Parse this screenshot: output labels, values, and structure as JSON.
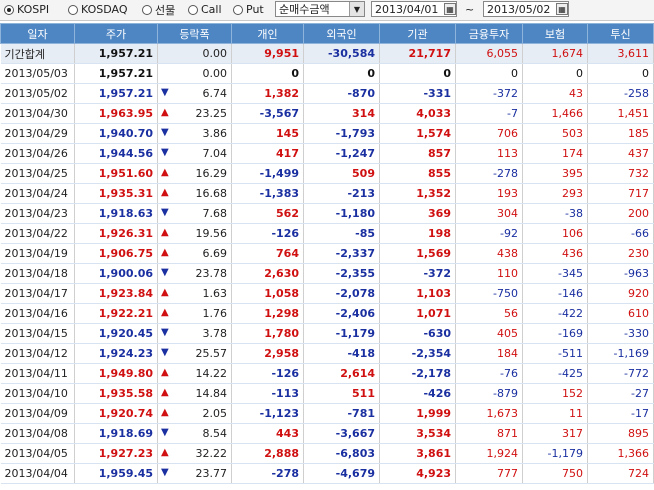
{
  "toolbar": {
    "radios": [
      {
        "label": "KOSPI",
        "selected": true
      },
      {
        "label": "KOSDAQ",
        "selected": false
      },
      {
        "label": "선물",
        "selected": false
      },
      {
        "label": "Call",
        "selected": false
      },
      {
        "label": "Put",
        "selected": false
      }
    ],
    "select_value": "순매수금액",
    "date_from": "2013/04/01",
    "date_to": "2013/05/02",
    "tilde": "~"
  },
  "colors": {
    "header": "#4e86c4",
    "up": "#d01010",
    "down": "#1a2fa0"
  },
  "columns": [
    "일자",
    "주가",
    "등락폭",
    "개인",
    "외국인",
    "기관",
    "금융투자",
    "보험",
    "투신"
  ],
  "rows": [
    {
      "date": "기간합계",
      "price": "1,957.21",
      "dir": "none",
      "change": "0.00",
      "retail": "9,951",
      "foreign": "-30,584",
      "inst": "21,717",
      "fin": "6,055",
      "ins": "1,674",
      "trust": "3,611"
    },
    {
      "date": "2013/05/03",
      "price": "1,957.21",
      "dir": "none",
      "change": "0.00",
      "retail": "0",
      "foreign": "0",
      "inst": "0",
      "fin": "0",
      "ins": "0",
      "trust": "0"
    },
    {
      "date": "2013/05/02",
      "price": "1,957.21",
      "dir": "down",
      "change": "6.74",
      "retail": "1,382",
      "foreign": "-870",
      "inst": "-331",
      "fin": "-372",
      "ins": "43",
      "trust": "-258"
    },
    {
      "date": "2013/04/30",
      "price": "1,963.95",
      "dir": "up",
      "change": "23.25",
      "retail": "-3,567",
      "foreign": "314",
      "inst": "4,033",
      "fin": "-7",
      "ins": "1,466",
      "trust": "1,451"
    },
    {
      "date": "2013/04/29",
      "price": "1,940.70",
      "dir": "down",
      "change": "3.86",
      "retail": "145",
      "foreign": "-1,793",
      "inst": "1,574",
      "fin": "706",
      "ins": "503",
      "trust": "185"
    },
    {
      "date": "2013/04/26",
      "price": "1,944.56",
      "dir": "down",
      "change": "7.04",
      "retail": "417",
      "foreign": "-1,247",
      "inst": "857",
      "fin": "113",
      "ins": "174",
      "trust": "437"
    },
    {
      "date": "2013/04/25",
      "price": "1,951.60",
      "dir": "up",
      "change": "16.29",
      "retail": "-1,499",
      "foreign": "509",
      "inst": "855",
      "fin": "-278",
      "ins": "395",
      "trust": "732"
    },
    {
      "date": "2013/04/24",
      "price": "1,935.31",
      "dir": "up",
      "change": "16.68",
      "retail": "-1,383",
      "foreign": "-213",
      "inst": "1,352",
      "fin": "193",
      "ins": "293",
      "trust": "717"
    },
    {
      "date": "2013/04/23",
      "price": "1,918.63",
      "dir": "down",
      "change": "7.68",
      "retail": "562",
      "foreign": "-1,180",
      "inst": "369",
      "fin": "304",
      "ins": "-38",
      "trust": "200"
    },
    {
      "date": "2013/04/22",
      "price": "1,926.31",
      "dir": "up",
      "change": "19.56",
      "retail": "-126",
      "foreign": "-85",
      "inst": "198",
      "fin": "-92",
      "ins": "106",
      "trust": "-66"
    },
    {
      "date": "2013/04/19",
      "price": "1,906.75",
      "dir": "up",
      "change": "6.69",
      "retail": "764",
      "foreign": "-2,337",
      "inst": "1,569",
      "fin": "438",
      "ins": "436",
      "trust": "230"
    },
    {
      "date": "2013/04/18",
      "price": "1,900.06",
      "dir": "down",
      "change": "23.78",
      "retail": "2,630",
      "foreign": "-2,355",
      "inst": "-372",
      "fin": "110",
      "ins": "-345",
      "trust": "-963"
    },
    {
      "date": "2013/04/17",
      "price": "1,923.84",
      "dir": "up",
      "change": "1.63",
      "retail": "1,058",
      "foreign": "-2,078",
      "inst": "1,103",
      "fin": "-750",
      "ins": "-146",
      "trust": "920"
    },
    {
      "date": "2013/04/16",
      "price": "1,922.21",
      "dir": "up",
      "change": "1.76",
      "retail": "1,298",
      "foreign": "-2,406",
      "inst": "1,071",
      "fin": "56",
      "ins": "-422",
      "trust": "610"
    },
    {
      "date": "2013/04/15",
      "price": "1,920.45",
      "dir": "down",
      "change": "3.78",
      "retail": "1,780",
      "foreign": "-1,179",
      "inst": "-630",
      "fin": "405",
      "ins": "-169",
      "trust": "-330"
    },
    {
      "date": "2013/04/12",
      "price": "1,924.23",
      "dir": "down",
      "change": "25.57",
      "retail": "2,958",
      "foreign": "-418",
      "inst": "-2,354",
      "fin": "184",
      "ins": "-511",
      "trust": "-1,169"
    },
    {
      "date": "2013/04/11",
      "price": "1,949.80",
      "dir": "up",
      "change": "14.22",
      "retail": "-126",
      "foreign": "2,614",
      "inst": "-2,178",
      "fin": "-76",
      "ins": "-425",
      "trust": "-772"
    },
    {
      "date": "2013/04/10",
      "price": "1,935.58",
      "dir": "up",
      "change": "14.84",
      "retail": "-113",
      "foreign": "511",
      "inst": "-426",
      "fin": "-879",
      "ins": "152",
      "trust": "-27"
    },
    {
      "date": "2013/04/09",
      "price": "1,920.74",
      "dir": "up",
      "change": "2.05",
      "retail": "-1,123",
      "foreign": "-781",
      "inst": "1,999",
      "fin": "1,673",
      "ins": "11",
      "trust": "-17"
    },
    {
      "date": "2013/04/08",
      "price": "1,918.69",
      "dir": "down",
      "change": "8.54",
      "retail": "443",
      "foreign": "-3,667",
      "inst": "3,534",
      "fin": "871",
      "ins": "317",
      "trust": "895"
    },
    {
      "date": "2013/04/05",
      "price": "1,927.23",
      "dir": "up",
      "change": "32.22",
      "retail": "2,888",
      "foreign": "-6,803",
      "inst": "3,861",
      "fin": "1,924",
      "ins": "-1,179",
      "trust": "1,366"
    },
    {
      "date": "2013/04/04",
      "price": "1,959.45",
      "dir": "down",
      "change": "23.77",
      "retail": "-278",
      "foreign": "-4,679",
      "inst": "4,923",
      "fin": "777",
      "ins": "750",
      "trust": "724"
    }
  ]
}
